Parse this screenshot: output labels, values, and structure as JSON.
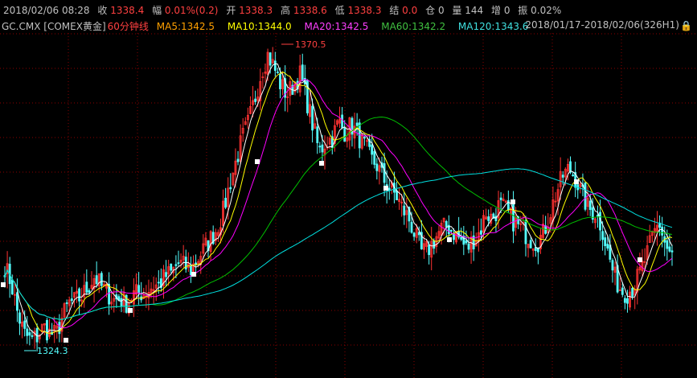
{
  "info": {
    "datetime": "2018/02/06 08:28",
    "close_label": "收",
    "close": "1338.4",
    "change_label": "幅",
    "change": "0.01%(0.2)",
    "open_label": "开",
    "open": "1338.3",
    "high_label": "高",
    "high": "1338.6",
    "low_label": "低",
    "low": "1338.3",
    "settle_label": "结",
    "settle": "0.0",
    "oi_label": "仓",
    "oi": "0",
    "volume_label": "量",
    "volume": "144",
    "oi_change_label": "增",
    "oi_change": "0",
    "amplitude_label": "振",
    "amplitude": "0.02%"
  },
  "ma_bar": {
    "symbol": "GC.CMX",
    "name": "[COMEX黄金]",
    "period": "60分钟线",
    "ma5": "MA5:1342.5",
    "ma10": "MA10:1344.0",
    "ma20": "MA20:1342.5",
    "ma60": "MA60:1342.2",
    "ma120": "MA120:1343.6",
    "range": "2018/01/17-2018/02/06(326H1)"
  },
  "colors": {
    "up": "#ff3232",
    "down": "#54ffff",
    "ma5": "#ffffff",
    "ma10": "#ffff00",
    "ma20": "#ff00ff",
    "ma60": "#00c000",
    "ma120": "#00e0e0",
    "grid": "#8b0000",
    "label_up": "#ff4040",
    "label_ma5": "#ffa000"
  },
  "chart_data": {
    "type": "candlestick",
    "period": "60分钟线",
    "y_range": [
      1324.3,
      1370.5
    ],
    "high_annotation": "1370.5",
    "low_annotation": "1324.3",
    "grid": true,
    "series": [
      {
        "name": "MA5",
        "last": 1342.5
      },
      {
        "name": "MA10",
        "last": 1344.0
      },
      {
        "name": "MA20",
        "last": 1342.5
      },
      {
        "name": "MA60",
        "last": 1342.2
      },
      {
        "name": "MA120",
        "last": 1343.6
      }
    ],
    "close_path": [
      1337.0,
      1334.5,
      1330.0,
      1327.0,
      1326.0,
      1326.5,
      1328.0,
      1327.0,
      1326.8,
      1329.5,
      1331.5,
      1331.8,
      1332.5,
      1334.0,
      1335.5,
      1334.0,
      1333.0,
      1332.0,
      1332.2,
      1331.5,
      1332.8,
      1333.0,
      1333.2,
      1334.0,
      1334.2,
      1335.5,
      1336.0,
      1337.5,
      1337.0,
      1336.5,
      1338.0,
      1339.5,
      1341.0,
      1342.5,
      1345.0,
      1349.0,
      1352.5,
      1356.0,
      1358.5,
      1362.0,
      1366.0,
      1368.5,
      1366.5,
      1364.0,
      1362.5,
      1364.0,
      1365.5,
      1362.0,
      1358.0,
      1354.0,
      1355.5,
      1356.0,
      1358.5,
      1357.0,
      1358.0,
      1356.5,
      1355.0,
      1353.0,
      1352.0,
      1350.0,
      1348.5,
      1347.5,
      1345.5,
      1344.0,
      1341.5,
      1339.0,
      1339.5,
      1341.0,
      1342.5,
      1343.0,
      1342.0,
      1341.0,
      1339.5,
      1341.0,
      1342.0,
      1345.0,
      1344.0,
      1346.0,
      1345.5,
      1344.0,
      1343.0,
      1342.0,
      1341.0,
      1340.5,
      1342.0,
      1345.0,
      1348.0,
      1350.5,
      1351.5,
      1350.0,
      1347.5,
      1345.5,
      1345.0,
      1343.0,
      1339.0,
      1335.5,
      1333.5,
      1333.0,
      1334.0,
      1336.0,
      1338.5,
      1341.5,
      1343.5,
      1340.0,
      1338.4
    ]
  }
}
